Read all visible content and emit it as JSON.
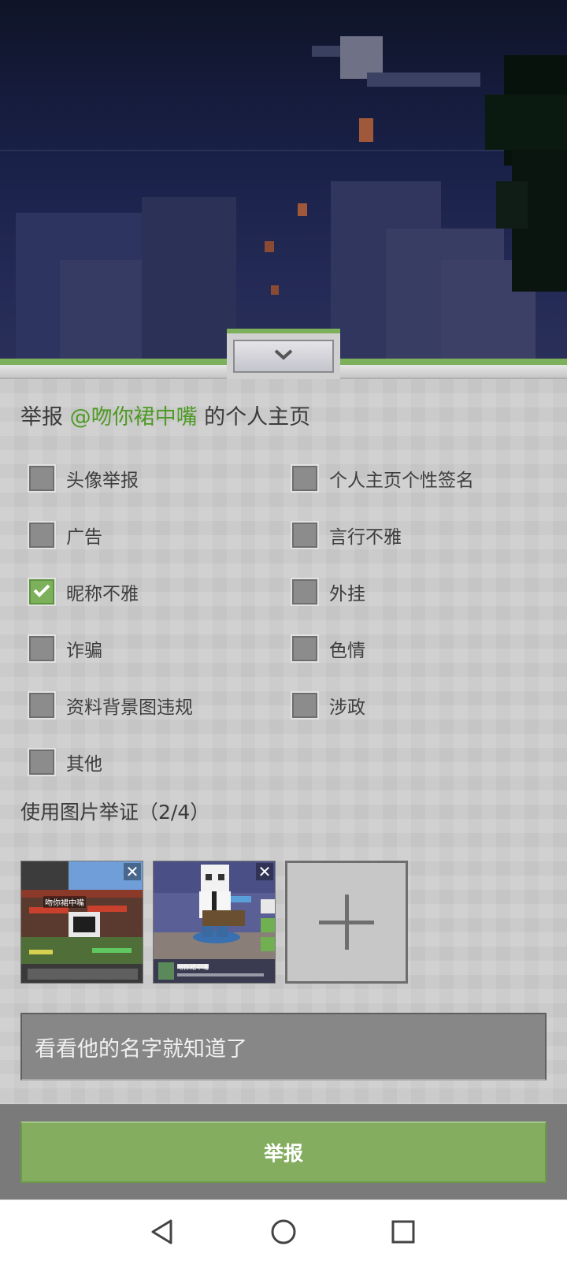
{
  "header": {
    "collapse_icon": "chevron-down-icon"
  },
  "report": {
    "prefix": "举报 ",
    "username": "@吻你裙中嘴",
    "suffix": " 的个人主页"
  },
  "options": [
    {
      "label": "头像举报",
      "checked": false
    },
    {
      "label": "个人主页个性签名",
      "checked": false
    },
    {
      "label": "广告",
      "checked": false
    },
    {
      "label": "言行不雅",
      "checked": false
    },
    {
      "label": "昵称不雅",
      "checked": true
    },
    {
      "label": "外挂",
      "checked": false
    },
    {
      "label": "诈骗",
      "checked": false
    },
    {
      "label": "色情",
      "checked": false
    },
    {
      "label": "资料背景图违规",
      "checked": false
    },
    {
      "label": "涉政",
      "checked": false
    },
    {
      "label": "其他",
      "checked": false
    }
  ],
  "evidence": {
    "title": "使用图片举证（2/4）",
    "remove_symbol": "✕",
    "thumb1_caption": "吻你裙中嘴",
    "thumb2_caption": "吻你裙中嘴"
  },
  "comment": {
    "value": "看看他的名字就知道了"
  },
  "submit": {
    "label": "举报"
  },
  "colors": {
    "accent_green": "#7db05a",
    "username_green": "#4e9a24",
    "submit_green": "#84ad5f"
  }
}
